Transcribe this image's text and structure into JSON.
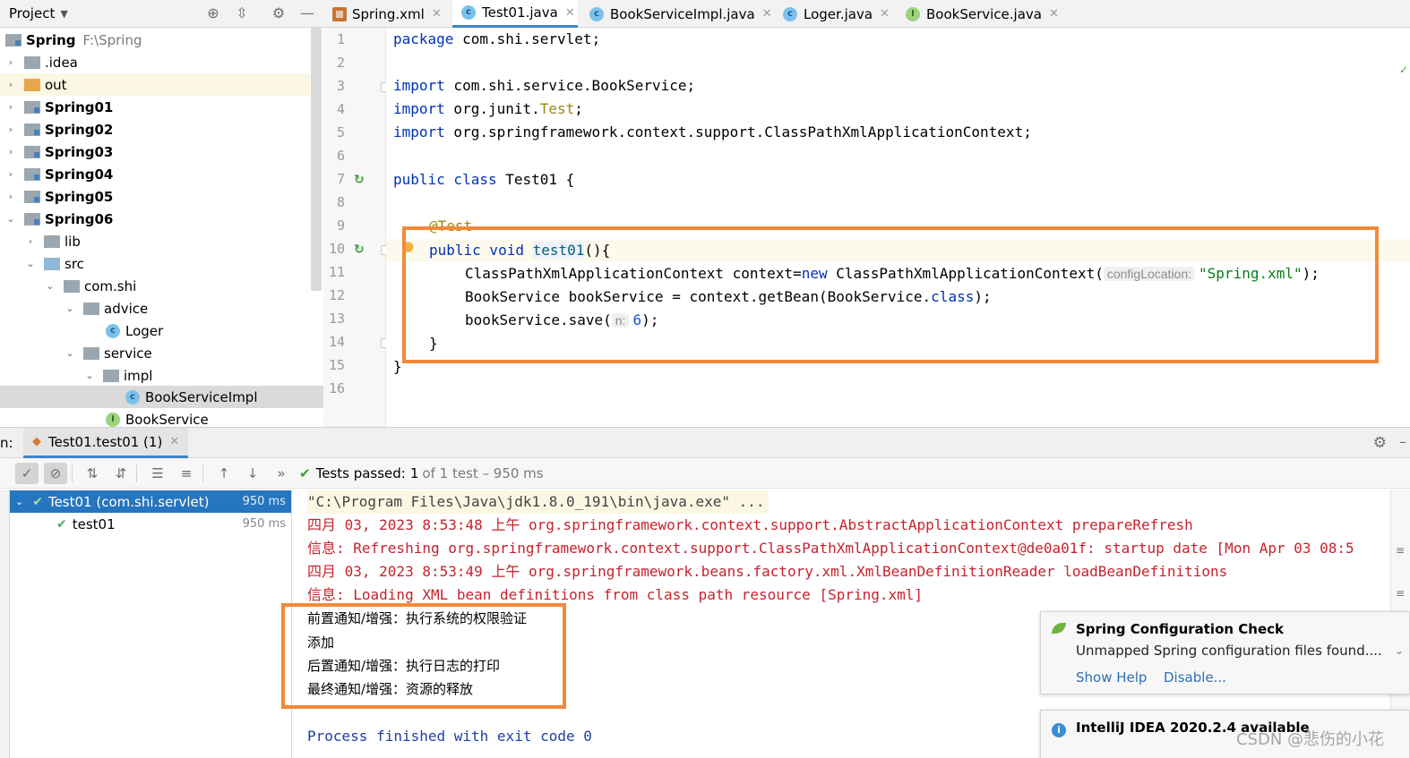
{
  "project_panel": {
    "title": "Project",
    "tree": [
      {
        "label": "Spring",
        "path": "F:\\Spring"
      },
      {
        "label": ".idea"
      },
      {
        "label": "out"
      },
      {
        "label": "Spring01"
      },
      {
        "label": "Spring02"
      },
      {
        "label": "Spring03"
      },
      {
        "label": "Spring04"
      },
      {
        "label": "Spring05"
      },
      {
        "label": "Spring06"
      },
      {
        "label": "lib"
      },
      {
        "label": "src"
      },
      {
        "label": "com.shi"
      },
      {
        "label": "advice"
      },
      {
        "label": "Loger"
      },
      {
        "label": "service"
      },
      {
        "label": "impl"
      },
      {
        "label": "BookServiceImpl"
      },
      {
        "label": "BookService"
      }
    ]
  },
  "editor": {
    "tabs": [
      {
        "label": "Spring.xml",
        "icon": "xml-file-icon"
      },
      {
        "label": "Test01.java",
        "icon": "class-icon",
        "active": true
      },
      {
        "label": "BookServiceImpl.java",
        "icon": "class-icon"
      },
      {
        "label": "Loger.java",
        "icon": "class-icon"
      },
      {
        "label": "BookService.java",
        "icon": "interface-icon"
      }
    ],
    "line_numbers": [
      "1",
      "2",
      "3",
      "4",
      "5",
      "6",
      "7",
      "8",
      "9",
      "10",
      "11",
      "12",
      "13",
      "14",
      "15",
      "16"
    ],
    "code": {
      "l1_kw": "package",
      "l1_rest": " com.shi.servlet;",
      "l3_kw": "import",
      "l3_rest": " com.shi.service.BookService;",
      "l4_kw": "import",
      "l4_rest": " org.junit.",
      "l4_ann": "Test",
      "l4_end": ";",
      "l5_kw": "import",
      "l5_rest": " org.springframework.context.support.ClassPathXmlApplicationContext;",
      "l7_kw": "public class",
      "l7_rest": " Test01 {",
      "l9_ann": "@Test",
      "l10_kw": "public void",
      "l10_fn": "test01",
      "l10_rest": "(){",
      "l11_a": "ClassPathXmlApplicationContext context=",
      "l11_kw": "new",
      "l11_b": " ClassPathXmlApplicationContext(",
      "l11_hint": "configLocation:",
      "l11_str": "\"Spring.xml\"",
      "l11_end": ");",
      "l12_a": "BookService bookService = context.getBean(BookService.",
      "l12_kw": "class",
      "l12_end": ");",
      "l13_a": "bookService.save(",
      "l13_hint": "n:",
      "l13_num": "6",
      "l13_end": ");",
      "l14": "}",
      "l15": "}"
    }
  },
  "run_window": {
    "label": "n:",
    "tab_label": "Test01.test01 (1)",
    "tests_passed_label": "Tests passed:",
    "tests_passed_count": "1",
    "tests_passed_detail": "of 1 test – 950 ms",
    "test_tree": [
      {
        "label": "Test01 (com.shi.servlet)",
        "time": "950 ms"
      },
      {
        "label": "test01",
        "time": "950 ms"
      }
    ],
    "console": {
      "cmd": "\"C:\\Program Files\\Java\\jdk1.8.0_191\\bin\\java.exe\" ...",
      "log1": "四月 03, 2023 8:53:48 上午 org.springframework.context.support.AbstractApplicationContext prepareRefresh",
      "log2": "信息: Refreshing org.springframework.context.support.ClassPathXmlApplicationContext@de0a01f: startup date [Mon Apr 03 08:5",
      "log3": "四月 03, 2023 8:53:49 上午 org.springframework.beans.factory.xml.XmlBeanDefinitionReader loadBeanDefinitions",
      "log4": "信息: Loading XML bean definitions from class path resource [Spring.xml]",
      "out1": "前置通知/增强：执行系统的权限验证",
      "out2": "添加",
      "out3": "后置通知/增强：执行日志的打印",
      "out4": "最终通知/增强：资源的释放",
      "finish": "Process finished with exit code 0"
    }
  },
  "notifications": {
    "spring": {
      "title": "Spring Configuration Check",
      "body": "Unmapped Spring configuration files found....",
      "show_help": "Show Help",
      "disable": "Disable..."
    },
    "idea": {
      "title": "IntelliJ IDEA 2020.2.4 available"
    }
  },
  "watermark": "CSDN @悲伤的小花",
  "colors": {
    "highlight_box": "#f2893a",
    "selection": "#2675bf",
    "keyword": "#0033b3",
    "log_red": "#c7222d",
    "pass_green": "#3d9c3d"
  }
}
